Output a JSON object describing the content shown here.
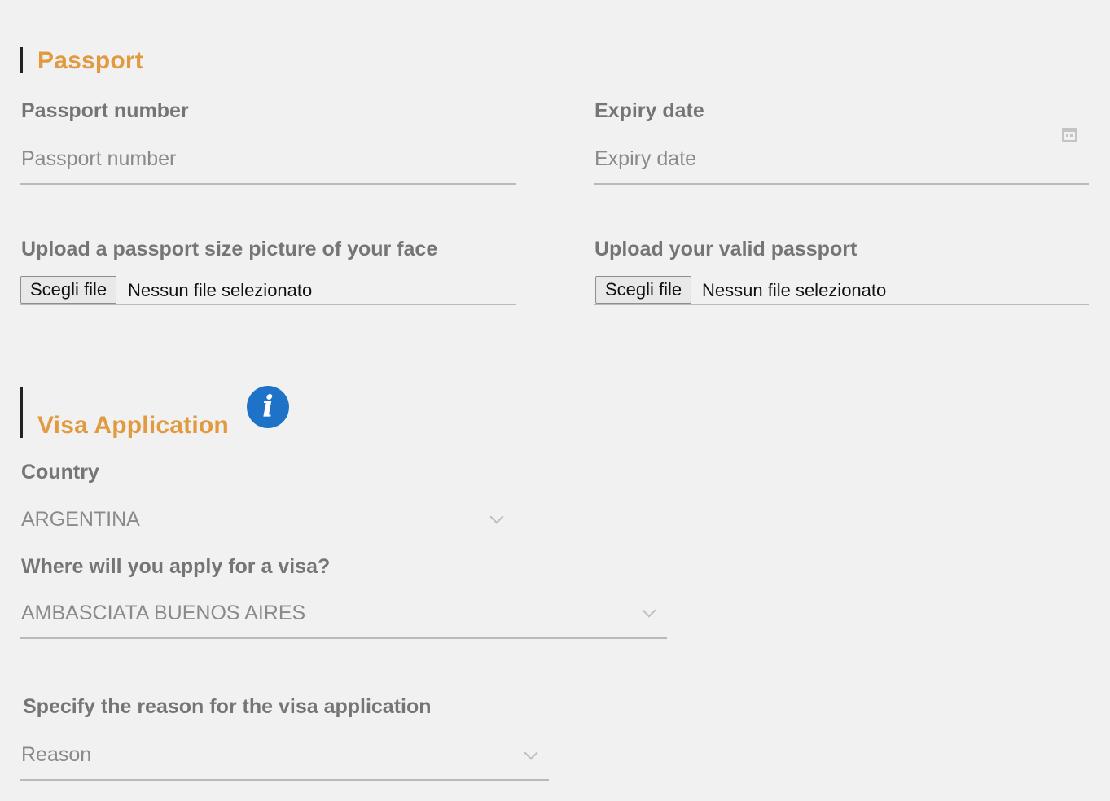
{
  "passport": {
    "title": "Passport",
    "number_label": "Passport number",
    "number_placeholder": "Passport number",
    "expiry_label": "Expiry date",
    "expiry_placeholder": "Expiry date",
    "face_upload_label": "Upload a passport size picture of your face",
    "passport_upload_label": "Upload your valid passport",
    "choose_file_label": "Scegli file",
    "no_file_text": "Nessun file selezionato"
  },
  "visa": {
    "title": "Visa Application",
    "country_label": "Country",
    "country_value": "ARGENTINA",
    "apply_label": "Where will you apply for a visa?",
    "apply_value": "AMBASCIATA BUENOS AIRES",
    "reason_label": "Specify the reason for the visa application",
    "reason_placeholder": "Reason"
  },
  "icons": {
    "info": "info-icon",
    "calendar": "calendar-icon",
    "chevron": "chevron-down-icon"
  },
  "colors": {
    "section_title": "#e19a3f",
    "info_icon": "#1e73c8",
    "background": "#f1f1f1"
  }
}
